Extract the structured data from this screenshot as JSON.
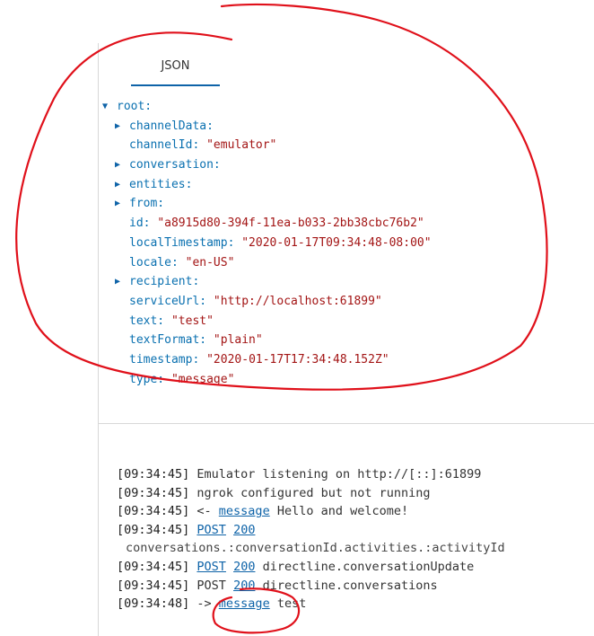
{
  "tab": {
    "label": "JSON"
  },
  "tree": {
    "root_label": "root:",
    "rows": [
      {
        "key": "channelData:",
        "value": "",
        "expandable": true
      },
      {
        "key": "channelId:",
        "value": "\"emulator\"",
        "expandable": false
      },
      {
        "key": "conversation:",
        "value": "",
        "expandable": true
      },
      {
        "key": "entities:",
        "value": "",
        "expandable": true
      },
      {
        "key": "from:",
        "value": "",
        "expandable": true
      },
      {
        "key": "id:",
        "value": "\"a8915d80-394f-11ea-b033-2bb38cbc76b2\"",
        "expandable": false
      },
      {
        "key": "localTimestamp:",
        "value": "\"2020-01-17T09:34:48-08:00\"",
        "expandable": false
      },
      {
        "key": "locale:",
        "value": "\"en-US\"",
        "expandable": false
      },
      {
        "key": "recipient:",
        "value": "",
        "expandable": true
      },
      {
        "key": "serviceUrl:",
        "value": "\"http://localhost:61899\"",
        "expandable": false
      },
      {
        "key": "text:",
        "value": "\"test\"",
        "expandable": false
      },
      {
        "key": "textFormat:",
        "value": "\"plain\"",
        "expandable": false
      },
      {
        "key": "timestamp:",
        "value": "\"2020-01-17T17:34:48.152Z\"",
        "expandable": false
      },
      {
        "key": "type:",
        "value": "\"message\"",
        "expandable": false
      }
    ]
  },
  "log": {
    "lines": [
      {
        "ts": "[09:34:45]",
        "text": " Emulator listening on http://[::]:61899"
      },
      {
        "ts": "[09:34:45]",
        "text": " ngrok configured but not running"
      },
      {
        "ts": "[09:34:45]",
        "prefix": " <- ",
        "link": "message",
        "text": " Hello and welcome!"
      },
      {
        "ts": "[09:34:45]",
        "link": "POST",
        "status": "200",
        "text": ""
      },
      {
        "continuation": "conversations.:conversationId.activities.:activityId"
      },
      {
        "ts": "[09:34:45]",
        "link": "POST",
        "status": "200",
        "text": " directline.conversationUpdate"
      },
      {
        "ts": "[09:34:45]",
        "plain": " POST ",
        "status": "200",
        "text": " directline.conversations"
      },
      {
        "ts": "[09:34:48]",
        "prefix": " -> ",
        "link": "message",
        "text": " test"
      }
    ]
  },
  "colors": {
    "link": "#0e63a8",
    "json_key": "#0a70b0",
    "json_value": "#a31515",
    "annotation": "#e0101a"
  }
}
